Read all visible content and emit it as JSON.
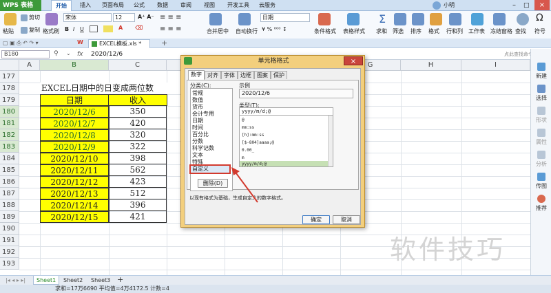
{
  "app": {
    "name": "WPS 表格",
    "user": "小明"
  },
  "menu": [
    "开始",
    "插入",
    "页面布局",
    "公式",
    "数据",
    "审阅",
    "视图",
    "开发工具",
    "云服务"
  ],
  "ribbon": {
    "paste": "粘贴",
    "cut": "剪切",
    "copy": "复制",
    "format_painter": "格式刷",
    "font": "宋体",
    "font_size": "12",
    "merge": "合并居中",
    "wrap": "自动换行",
    "number_format": "日期",
    "conditional": "条件格式",
    "table_style": "表格样式",
    "sum": "求和",
    "filter": "筛选",
    "sort": "排序",
    "format": "格式",
    "rowcol": "行和列",
    "worksheet": "工作表",
    "freeze": "冻结窗格",
    "find": "查找",
    "symbol": "符号"
  },
  "doc_tab": "EXCEL模板.xls *",
  "formula_bar": {
    "cell_ref": "B180",
    "fx": "fx",
    "value": "2020/12/6",
    "search": "点此查找命令"
  },
  "columns": [
    "A",
    "B",
    "C",
    "D",
    "E",
    "F",
    "G",
    "H",
    "I"
  ],
  "rows": [
    "177",
    "178",
    "179",
    "180",
    "181",
    "182",
    "183",
    "184",
    "185",
    "186",
    "187",
    "188",
    "189",
    "190",
    "191",
    "192",
    "193"
  ],
  "title_text": "EXCEL日期中的日变成两位数",
  "headers": {
    "date": "日期",
    "income": "收入"
  },
  "data_rows": [
    {
      "date": "2020/12/6",
      "income": "350"
    },
    {
      "date": "2020/12/7",
      "income": "420"
    },
    {
      "date": "2020/12/8",
      "income": "320"
    },
    {
      "date": "2020/12/9",
      "income": "322"
    },
    {
      "date": "2020/12/10",
      "income": "398"
    },
    {
      "date": "2020/12/11",
      "income": "562"
    },
    {
      "date": "2020/12/12",
      "income": "423"
    },
    {
      "date": "2020/12/13",
      "income": "512"
    },
    {
      "date": "2020/12/14",
      "income": "396"
    },
    {
      "date": "2020/12/15",
      "income": "421"
    }
  ],
  "dialog": {
    "title": "单元格格式",
    "close": "×",
    "tabs": [
      "数字",
      "对齐",
      "字体",
      "边框",
      "图案",
      "保护"
    ],
    "category_label": "分类(C):",
    "categories": [
      "常规",
      "数值",
      "货币",
      "会计专用",
      "日期",
      "时间",
      "百分比",
      "分数",
      "科学记数",
      "文本",
      "特殊",
      "自定义"
    ],
    "sample_label": "示例",
    "sample_value": "2020/12/6",
    "type_label": "类型(T):",
    "type_value": "yyyy/m/d;@",
    "type_list": [
      "@",
      "mm:ss",
      "[h]:mm:ss",
      "[$-804]aaaa;@",
      "0.00_",
      "m",
      "yyyy/m/d;@"
    ],
    "delete_btn": "删除(D)",
    "hint": "以现有格式为基础，生成自定义的数字格式。",
    "ok": "确定",
    "cancel": "取消"
  },
  "sheets": [
    "Sheet1",
    "Sheet2",
    "Sheet3"
  ],
  "status": {
    "text": "求和=17万6690  平均值=4万4172.5  计数=4"
  },
  "side_panel": [
    "新建",
    "选择",
    "形状",
    "属性",
    "分析",
    "传图",
    "推荐"
  ],
  "watermark": "软件技巧",
  "colors": {
    "highlight": "#ffff00",
    "selected_header": "#d9e9d2",
    "dialog_frame": "#f3cf7d",
    "accent_red": "#d23a2e",
    "app_green": "#3d9a3a"
  }
}
